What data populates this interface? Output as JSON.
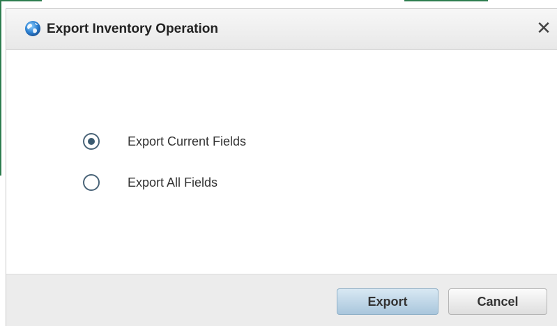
{
  "dialog": {
    "title": "Export Inventory Operation",
    "title_icon": "globe-icon",
    "close_glyph": "✕"
  },
  "options": [
    {
      "label": "Export Current Fields",
      "selected": true
    },
    {
      "label": "Export All Fields",
      "selected": false
    }
  ],
  "footer": {
    "export_label": "Export",
    "cancel_label": "Cancel"
  },
  "colors": {
    "accent_button": "#a9c6dc",
    "radio_dot": "#3a5a70",
    "app_edge": "#2e7d4f"
  }
}
